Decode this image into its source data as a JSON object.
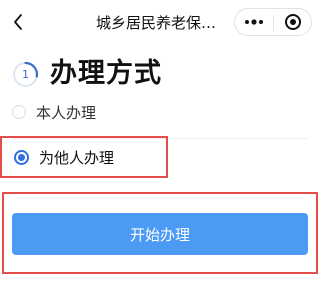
{
  "header": {
    "back_icon": "chevron-left-icon",
    "title": "城乡居民养老保险...",
    "more_icon": "more-dots-icon",
    "close_icon": "target-close-icon"
  },
  "step": {
    "number": "1",
    "title": "办理方式"
  },
  "options": [
    {
      "label": "本人办理",
      "selected": false
    },
    {
      "label": "为他人办理",
      "selected": true
    }
  ],
  "actions": {
    "start_label": "开始办理"
  },
  "colors": {
    "accent": "#2f6fe0",
    "button": "#4b9af3",
    "highlight": "#e54c4c"
  }
}
